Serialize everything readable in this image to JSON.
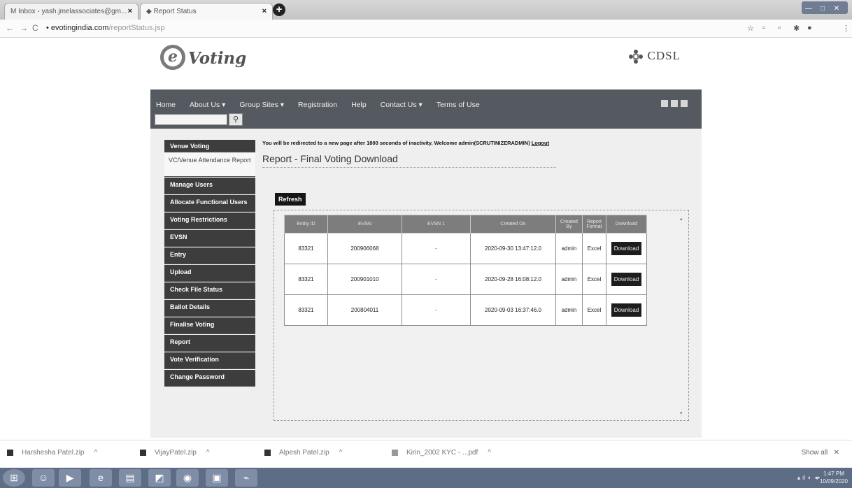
{
  "browser": {
    "tabs": [
      {
        "label": "M Inbox - yash.jmelassociates@gm..."
      },
      {
        "label": "Report Status"
      }
    ],
    "url_host": "evotingindia.com",
    "url_path": "/reportStatus.jsp"
  },
  "header": {
    "logo_letter": "e",
    "logo_text": "Voting",
    "brand": "CDSL"
  },
  "menu": {
    "items": [
      "Home",
      "About Us ▾",
      "Group Sites ▾",
      "Registration",
      "Help",
      "Contact Us ▾",
      "Terms of Use"
    ],
    "search_button_icon": "🔍"
  },
  "sidebar": {
    "items": [
      "Venue Voting",
      "VC/Venue Attendance Report",
      "Manage Users",
      "Allocate Functional Users",
      "Voting Restrictions",
      "EVSN",
      "Entry",
      "Upload",
      "Check File Status",
      "Ballot Details",
      "Finalise Voting",
      "Report",
      "Vote Verification",
      "Change Password"
    ]
  },
  "main": {
    "notice": "You will be redirected to a new page after 1800 seconds of inactivity. Welcome admin(SCRUTINIZERADMIN)",
    "logout": "Logout",
    "title": "Report - Final Voting Download",
    "refresh": "Refresh",
    "columns": [
      "Entity ID",
      "EVSN",
      "EVSN 1",
      "Created On",
      "Created By",
      "Report Format",
      "Download"
    ],
    "rows": [
      {
        "entity": "83321",
        "evsn": "200906068",
        "evsn1": "-",
        "created_on": "2020-09-30 13:47:12.0",
        "by": "admin",
        "format": "Excel",
        "action": "Download"
      },
      {
        "entity": "83321",
        "evsn": "200901010",
        "evsn1": "-",
        "created_on": "2020-09-28 16:08:12.0",
        "by": "admin",
        "format": "Excel",
        "action": "Download"
      },
      {
        "entity": "83321",
        "evsn": "200804011",
        "evsn1": "-",
        "created_on": "2020-09-03 16:37:46.0",
        "by": "admin",
        "format": "Excel",
        "action": "Download"
      }
    ]
  },
  "downloads": {
    "items": [
      "Harshesha Patel.zip",
      "VijayPatel.zip",
      "Alpesh Patel.zip",
      "Kirin_2002 KYC - ...pdf"
    ],
    "show_all": "Show all"
  },
  "taskbar": {
    "time": "1:47 PM",
    "date": "10/09/2020"
  }
}
